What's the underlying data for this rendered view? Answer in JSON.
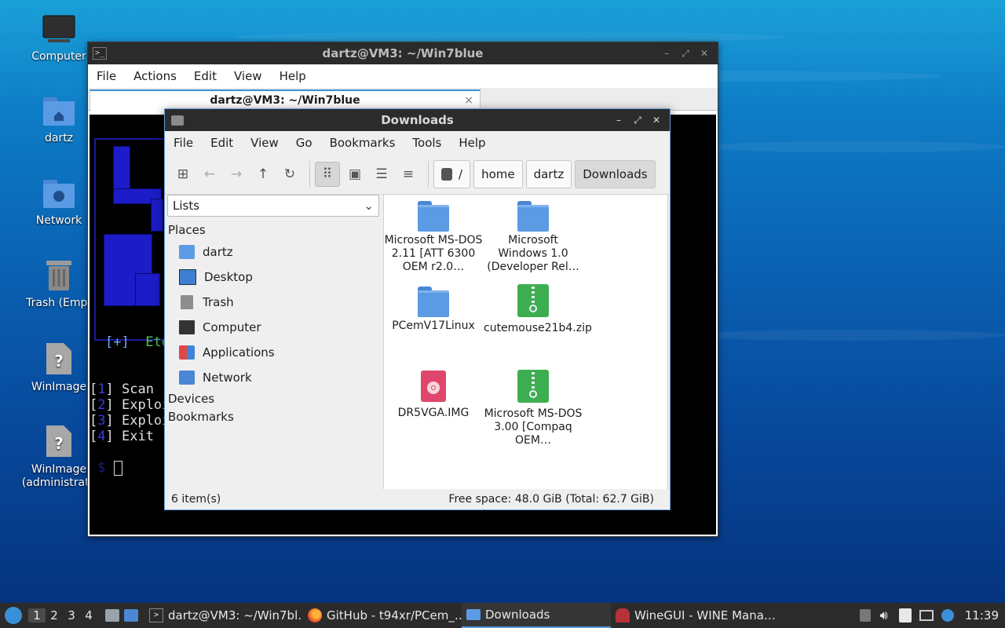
{
  "desktop": {
    "icons": [
      {
        "label": "Computer"
      },
      {
        "label": "dartz"
      },
      {
        "label": "Network"
      },
      {
        "label": "Trash (Empt"
      },
      {
        "label": "WinImage"
      },
      {
        "label": "WinImage",
        "label2": "(administrato"
      }
    ]
  },
  "terminal": {
    "title": "dartz@VM3: ~/Win7blue",
    "menu": [
      "File",
      "Actions",
      "Edit",
      "View",
      "Help"
    ],
    "tab_label": "dartz@VM3: ~/Win7blue",
    "tab_close": "×",
    "banner_status": "[+]",
    "banner_text": "Ete",
    "options": [
      {
        "num": "1",
        "text": "Scan"
      },
      {
        "num": "2",
        "text": "Exploi"
      },
      {
        "num": "3",
        "text": "Exploi"
      },
      {
        "num": "4",
        "text": "Exit"
      }
    ],
    "prompt": "$"
  },
  "file_manager": {
    "title": "Downloads",
    "menu": [
      "File",
      "Edit",
      "View",
      "Go",
      "Bookmarks",
      "Tools",
      "Help"
    ],
    "breadcrumb": [
      "/",
      "home",
      "dartz",
      "Downloads"
    ],
    "side_pane_mode": "Lists",
    "places_header": "Places",
    "places": [
      {
        "label": "dartz",
        "icon": "home-folder-icon"
      },
      {
        "label": "Desktop",
        "icon": "desktop-icon"
      },
      {
        "label": "Trash",
        "icon": "trash-icon"
      },
      {
        "label": "Computer",
        "icon": "computer-icon"
      },
      {
        "label": "Applications",
        "icon": "applications-icon"
      },
      {
        "label": "Network",
        "icon": "network-icon"
      }
    ],
    "devices_header": "Devices",
    "bookmarks_header": "Bookmarks",
    "items": [
      {
        "name": "Microsoft MS-DOS 2.11 [ATT 6300 OEM r2.0…",
        "type": "folder"
      },
      {
        "name": "Microsoft Windows 1.0 (Developer Rel…",
        "type": "folder"
      },
      {
        "name": "PCemV17Linux",
        "type": "folder"
      },
      {
        "name": "cutemouse21b4.zip",
        "type": "zip"
      },
      {
        "name": "DR5VGA.IMG",
        "type": "disk-image"
      },
      {
        "name": "Microsoft MS-DOS 3.00 [Compaq OEM…",
        "type": "zip"
      }
    ],
    "status_count": "6 item(s)",
    "status_free": "Free space: 48.0 GiB (Total: 62.7 GiB)"
  },
  "taskbar": {
    "workspaces": [
      "1",
      "2",
      "3",
      "4"
    ],
    "tasks": [
      {
        "label": "dartz@VM3: ~/Win7bl…",
        "icon": "terminal-icon"
      },
      {
        "label": "GitHub - t94xr/PCem_…",
        "icon": "firefox-icon"
      },
      {
        "label": "Downloads",
        "icon": "folder-icon",
        "active": true
      },
      {
        "label": "WineGUI - WINE Mana…",
        "icon": "wine-icon"
      }
    ],
    "clock": "11:39"
  }
}
